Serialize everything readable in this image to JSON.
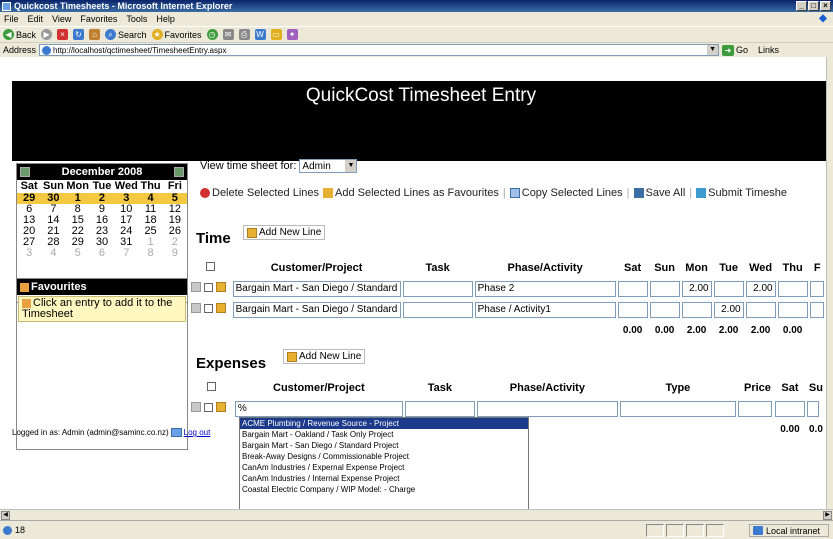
{
  "window": {
    "title": "Quickcost Timesheets - Microsoft Internet Explorer",
    "min": "_",
    "max": "□",
    "close": "×"
  },
  "menu": [
    "File",
    "Edit",
    "View",
    "Favorites",
    "Tools",
    "Help"
  ],
  "toolbar": {
    "back": "Back",
    "search": "Search",
    "favorites": "Favorites"
  },
  "address": {
    "label": "Address",
    "url": "http://localhost/qctimesheet/TimesheetEntry.aspx",
    "go": "Go",
    "links": "Links"
  },
  "header": {
    "title": "QuickCost Timesheet Entry"
  },
  "calendar": {
    "month": "December 2008",
    "dow": [
      "Sat",
      "Sun",
      "Mon",
      "Tue",
      "Wed",
      "Thu",
      "Fri"
    ],
    "weeks": [
      [
        {
          "d": "29",
          "c": "cur"
        },
        {
          "d": "30",
          "c": "cur"
        },
        {
          "d": "1",
          "c": "cur"
        },
        {
          "d": "2",
          "c": "cur"
        },
        {
          "d": "3",
          "c": "cur"
        },
        {
          "d": "4",
          "c": "cur"
        },
        {
          "d": "5",
          "c": "cur"
        }
      ],
      [
        {
          "d": "6"
        },
        {
          "d": "7"
        },
        {
          "d": "8"
        },
        {
          "d": "9"
        },
        {
          "d": "10"
        },
        {
          "d": "11"
        },
        {
          "d": "12"
        }
      ],
      [
        {
          "d": "13"
        },
        {
          "d": "14"
        },
        {
          "d": "15"
        },
        {
          "d": "16"
        },
        {
          "d": "17"
        },
        {
          "d": "18"
        },
        {
          "d": "19"
        }
      ],
      [
        {
          "d": "20"
        },
        {
          "d": "21"
        },
        {
          "d": "22"
        },
        {
          "d": "23"
        },
        {
          "d": "24"
        },
        {
          "d": "25"
        },
        {
          "d": "26"
        }
      ],
      [
        {
          "d": "27"
        },
        {
          "d": "28"
        },
        {
          "d": "29"
        },
        {
          "d": "30"
        },
        {
          "d": "31"
        },
        {
          "d": "1",
          "c": "other"
        },
        {
          "d": "2",
          "c": "other"
        }
      ],
      [
        {
          "d": "3",
          "c": "other"
        },
        {
          "d": "4",
          "c": "other"
        },
        {
          "d": "5",
          "c": "other"
        },
        {
          "d": "6",
          "c": "other"
        },
        {
          "d": "7",
          "c": "other"
        },
        {
          "d": "8",
          "c": "other"
        },
        {
          "d": "9",
          "c": "other"
        }
      ]
    ]
  },
  "favourites": {
    "title": "Favourites",
    "hint": "Click an entry to add it to the Timesheet"
  },
  "login": {
    "text": "Logged in as: Admin (admin@saminc.co.nz)",
    "logout": "Log out"
  },
  "viewfor": {
    "label": "View time sheet for:",
    "value": "Admin"
  },
  "actions": {
    "delete": "Delete Selected Lines",
    "favourites": "Add Selected Lines as Favourites",
    "copy": "Copy Selected Lines",
    "save": "Save All",
    "submit": "Submit Timeshe"
  },
  "time": {
    "title": "Time",
    "add": "Add New Line",
    "columns": [
      "Customer/Project",
      "Task",
      "Phase/Activity",
      "Sat",
      "Sun",
      "Mon",
      "Tue",
      "Wed",
      "Thu",
      "F"
    ],
    "rows": [
      {
        "project": "Bargain Mart - San Diego / Standard P",
        "task": "",
        "phase": "Phase 2",
        "sat": "",
        "sun": "",
        "mon": "2.00",
        "tue": "",
        "wed": "2.00",
        "thu": ""
      },
      {
        "project": "Bargain Mart - San Diego / Standard P",
        "task": "",
        "phase": "Phase / Activity1",
        "sat": "",
        "sun": "",
        "mon": "",
        "tue": "2.00",
        "wed": "",
        "thu": ""
      }
    ],
    "totals": [
      "0.00",
      "0.00",
      "2.00",
      "2.00",
      "2.00",
      "0.00"
    ]
  },
  "expenses": {
    "title": "Expenses",
    "add": "Add New Line",
    "columns": [
      "Customer/Project",
      "Task",
      "Phase/Activity",
      "Type",
      "Price",
      "Sat",
      "Su"
    ],
    "row": {
      "project": "%",
      "task": "",
      "phase": "",
      "type": "",
      "price": "",
      "sat": ""
    },
    "totals": [
      "0.00",
      "0.0"
    ]
  },
  "suggestions": [
    "ACME Plumbing / Revenue Source - Project",
    "Bargain Mart - Oakland / Task Only Project",
    "Bargain Mart - San Diego / Standard Project",
    "Break-Away Designs / Commissionable Project",
    "CanAm Industries / Expernal Expense Project",
    "CanAm Industries / Internal Expense Project",
    "Coastal Electric Company / WIP Model: - Charge"
  ],
  "status": {
    "left": "18",
    "zone": "Local intranet"
  }
}
